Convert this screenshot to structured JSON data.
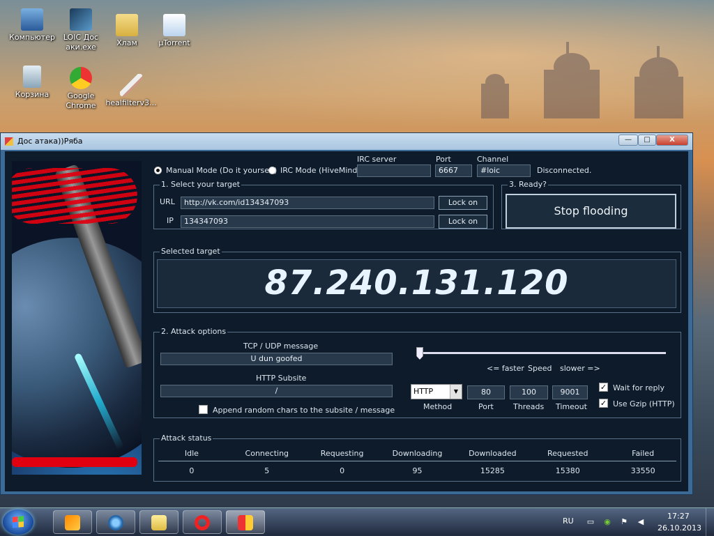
{
  "desktop": {
    "icons": [
      {
        "label": "Компьютер",
        "name": "computer"
      },
      {
        "label": "LOIC Дос аки.exe",
        "name": "loic-shortcut"
      },
      {
        "label": "Хлам",
        "name": "folder"
      },
      {
        "label": "µTorrent",
        "name": "utorrent"
      },
      {
        "label": "Корзина",
        "name": "recycle-bin"
      },
      {
        "label": "Google Chrome",
        "name": "chrome"
      },
      {
        "label": "healfilterv3...",
        "name": "healfilter"
      }
    ]
  },
  "window": {
    "title": "Дос атака))Ряба",
    "controls": {
      "minimize": "—",
      "maximize": "□",
      "close": "X"
    }
  },
  "mode": {
    "manual_label": "Manual Mode (Do it yourself)",
    "irc_label": "IRC Mode (HiveMind)",
    "selected": "manual"
  },
  "irc": {
    "server_label": "IRC server",
    "server_value": "",
    "port_label": "Port",
    "port_value": "6667",
    "channel_label": "Channel",
    "channel_value": "#loic",
    "status": "Disconnected."
  },
  "target": {
    "group_title": "1. Select your target",
    "url_label": "URL",
    "url_value": "http://vk.com/id134347093",
    "ip_label": "IP",
    "ip_value": "134347093",
    "lock_on_label": "Lock on"
  },
  "ready": {
    "group_title": "3. Ready?",
    "button_label": "Stop flooding"
  },
  "selected_target": {
    "group_title": "Selected target",
    "value": "87.240.131.120"
  },
  "attack": {
    "group_title": "2. Attack options",
    "message_label": "TCP / UDP message",
    "message_value": "U dun goofed",
    "subsite_label": "HTTP Subsite",
    "subsite_value": "/",
    "append_label": "Append random chars to the subsite / message",
    "append_checked": false,
    "speed_faster": "<= faster",
    "speed_label": "Speed",
    "speed_slower": "slower =>",
    "speed_value": 0,
    "method_value": "HTTP",
    "method_label": "Method",
    "port_value": "80",
    "port_label": "Port",
    "threads_value": "100",
    "threads_label": "Threads",
    "timeout_value": "9001",
    "timeout_label": "Timeout",
    "wait_label": "Wait for reply",
    "wait_checked": true,
    "gzip_label": "Use Gzip (HTTP)",
    "gzip_checked": true
  },
  "status": {
    "group_title": "Attack status",
    "headers": [
      "Idle",
      "Connecting",
      "Requesting",
      "Downloading",
      "Downloaded",
      "Requested",
      "Failed"
    ],
    "values": [
      "0",
      "5",
      "0",
      "95",
      "15285",
      "15380",
      "33550"
    ]
  },
  "taskbar": {
    "language": "RU",
    "time": "17:27",
    "date": "26.10.2013",
    "apps": [
      "media-player",
      "internet-explorer",
      "file-explorer",
      "opera",
      "loic"
    ]
  },
  "colors": {
    "window_frame": "#3c6a96",
    "client_bg": "#0d1b2a",
    "text": "#dde6ee",
    "redaction": "#e00010"
  }
}
